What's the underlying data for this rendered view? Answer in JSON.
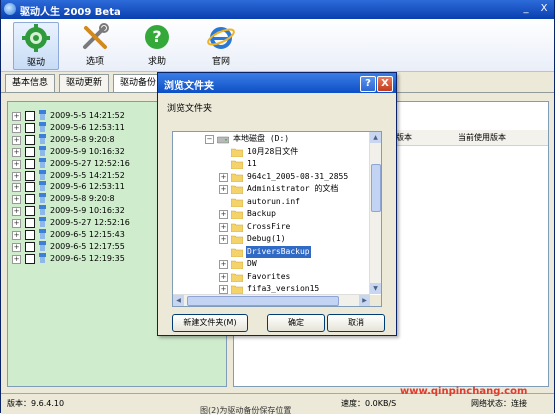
{
  "window": {
    "title": "驱动人生 2009 Beta",
    "minimize": "_",
    "close": "X"
  },
  "toolbar": [
    {
      "label": "驱动",
      "icon": "gear-icon"
    },
    {
      "label": "选项",
      "icon": "tools-icon"
    },
    {
      "label": "求助",
      "icon": "question-icon"
    },
    {
      "label": "官网",
      "icon": "browser-icon"
    }
  ],
  "tabs": [
    "基本信息",
    "驱动更新",
    "驱动备份"
  ],
  "backup_list": [
    "2009-5-5 14:21:52",
    "2009-5-6 12:53:11",
    "2009-5-8 9:20:8",
    "2009-5-9 10:16:32",
    "2009-5-27 12:52:16",
    "2009-5-5 14:21:52",
    "2009-5-6 12:53:11",
    "2009-5-8 9:20:8",
    "2009-5-9 10:16:32",
    "2009-5-27 12:52:16",
    "2009-6-5 12:15:43",
    "2009-6-5 12:17:55",
    "2009-6-5 12:19:35"
  ],
  "right_header": {
    "col1": "版本",
    "col2": "当前使用版本"
  },
  "status": {
    "version": "版本：9.6.4.10",
    "speed": "速度：0.0KB/S",
    "network": "网络状态：连接"
  },
  "watermark": "www.qinpinchang.com",
  "caption": "图(2)为驱动备份保存位置",
  "dialog": {
    "title": "浏览文件夹",
    "help": "?",
    "close": "X",
    "prompt": "浏览文件夹",
    "tree": [
      {
        "label": "本地磁盘 (D:)",
        "expander": "−",
        "indent": 0,
        "kind": "drive"
      },
      {
        "label": "10月28日文件",
        "expander": "",
        "indent": 1,
        "kind": "folder"
      },
      {
        "label": "11",
        "expander": "",
        "indent": 1,
        "kind": "folder"
      },
      {
        "label": "964c1_2005-08-31_2855",
        "expander": "+",
        "indent": 1,
        "kind": "folder"
      },
      {
        "label": "Administrator 的文档",
        "expander": "+",
        "indent": 1,
        "kind": "folder"
      },
      {
        "label": "autorun.inf",
        "expander": "",
        "indent": 1,
        "kind": "folder"
      },
      {
        "label": "Backup",
        "expander": "+",
        "indent": 1,
        "kind": "folder"
      },
      {
        "label": "CrossFire",
        "expander": "+",
        "indent": 1,
        "kind": "folder"
      },
      {
        "label": "Debug(1)",
        "expander": "+",
        "indent": 1,
        "kind": "folder"
      },
      {
        "label": "DriversBackup",
        "expander": "",
        "indent": 1,
        "kind": "folder",
        "selected": true
      },
      {
        "label": "DW",
        "expander": "+",
        "indent": 1,
        "kind": "folder"
      },
      {
        "label": "Favorites",
        "expander": "+",
        "indent": 1,
        "kind": "folder"
      },
      {
        "label": "fifa3_version15",
        "expander": "+",
        "indent": 1,
        "kind": "folder"
      }
    ],
    "buttons": {
      "new_folder": "新建文件夹(M)",
      "ok": "确定",
      "cancel": "取消"
    }
  },
  "colors": {
    "title_bar": "#0a3fb0",
    "left_panel": "#cfeccc",
    "selection": "#316ac5",
    "watermark": "#e03b2f"
  }
}
